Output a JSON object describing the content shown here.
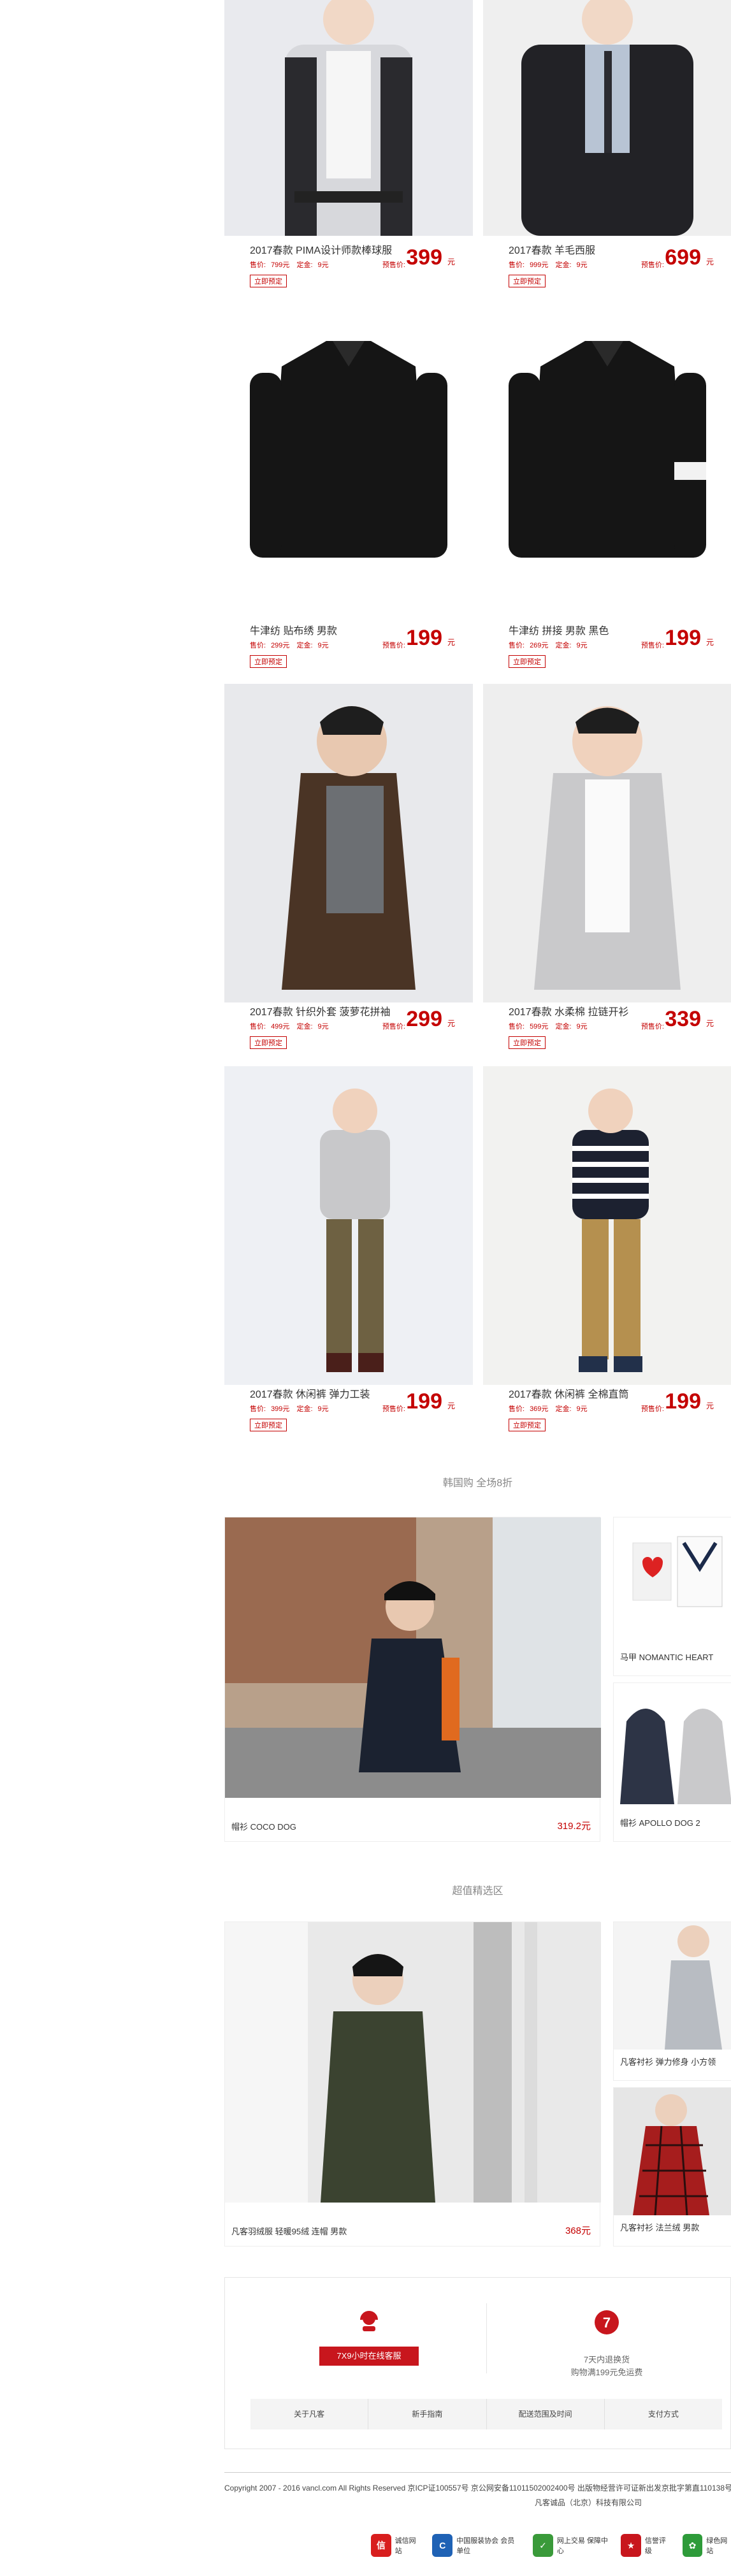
{
  "products": [
    {
      "name": "2017春款 PIMA设计师款棒球服",
      "sale_label": "售价:",
      "sale": "799元",
      "deposit_label": "定金:",
      "deposit": "9元",
      "pre_label": "预售价:",
      "pre": "399",
      "unit": "元",
      "button": "立即预定"
    },
    {
      "name": "2017春款 羊毛西服",
      "sale_label": "售价:",
      "sale": "999元",
      "deposit_label": "定金:",
      "deposit": "9元",
      "pre_label": "预售价:",
      "pre": "699",
      "unit": "元",
      "button": "立即预定"
    },
    {
      "name": "牛津纺 贴布绣 男款",
      "sale_label": "售价:",
      "sale": "299元",
      "deposit_label": "定金:",
      "deposit": "9元",
      "pre_label": "预售价:",
      "pre": "199",
      "unit": "元",
      "button": "立即预定"
    },
    {
      "name": "牛津纺 拼接 男款 黑色",
      "sale_label": "售价:",
      "sale": "269元",
      "deposit_label": "定金:",
      "deposit": "9元",
      "pre_label": "预售价:",
      "pre": "199",
      "unit": "元",
      "button": "立即预定"
    },
    {
      "name": "2017春款 针织外套 菠萝花拼袖",
      "sale_label": "售价:",
      "sale": "499元",
      "deposit_label": "定金:",
      "deposit": "9元",
      "pre_label": "预售价:",
      "pre": "299",
      "unit": "元",
      "button": "立即预定"
    },
    {
      "name": "2017春款 水柔棉 拉链开衫",
      "sale_label": "售价:",
      "sale": "599元",
      "deposit_label": "定金:",
      "deposit": "9元",
      "pre_label": "预售价:",
      "pre": "339",
      "unit": "元",
      "button": "立即预定"
    },
    {
      "name": "2017春款 休闲裤 弹力工装",
      "sale_label": "售价:",
      "sale": "399元",
      "deposit_label": "定金:",
      "deposit": "9元",
      "pre_label": "预售价:",
      "pre": "199",
      "unit": "元",
      "button": "立即预定"
    },
    {
      "name": "2017春款 休闲裤 全棉直筒",
      "sale_label": "售价:",
      "sale": "369元",
      "deposit_label": "定金:",
      "deposit": "9元",
      "pre_label": "预售价:",
      "pre": "199",
      "unit": "元",
      "button": "立即预定"
    }
  ],
  "korea": {
    "title": "韩国购 全场8折",
    "main": {
      "name": "帽衫 COCO DOG",
      "price": "319.2元"
    },
    "side1": {
      "name": "马甲 NOMANTIC HEART"
    },
    "side2": {
      "name": "帽衫 APOLLO DOG 2"
    }
  },
  "value": {
    "title": "超值精选区",
    "main": {
      "name": "凡客羽绒服 轻暖95绒 连帽 男款",
      "price": "368元"
    },
    "side1": {
      "name": "凡客衬衫 弹力修身 小方领"
    },
    "side2": {
      "name": "凡客衬衫 法兰绒 男款"
    }
  },
  "service": {
    "cta": "7X9小时在线客服",
    "return_title": "7天内退换货",
    "return_sub": "购物满199元免运费",
    "links": [
      "关于凡客",
      "新手指南",
      "配送范围及时间",
      "支付方式"
    ]
  },
  "footer": {
    "copyright": "Copyright 2007 - 2016 vancl.com All Rights Reserved 京ICP证100557号 京公网安备11011502002400号 出版物经营许可证新出发京批字第直110138号",
    "company": "凡客诚品（北京）科技有限公司",
    "badges": [
      {
        "label": "诚信网站",
        "color": "#d81e1e"
      },
      {
        "label": "中国服装协会 会员单位",
        "color": "#1f62b5"
      },
      {
        "label": "网上交易 保障中心",
        "color": "#3a9a3a"
      },
      {
        "label": "信誉评级",
        "color": "#c8161d"
      },
      {
        "label": "绿色网站",
        "color": "#2e9b3a"
      }
    ]
  }
}
